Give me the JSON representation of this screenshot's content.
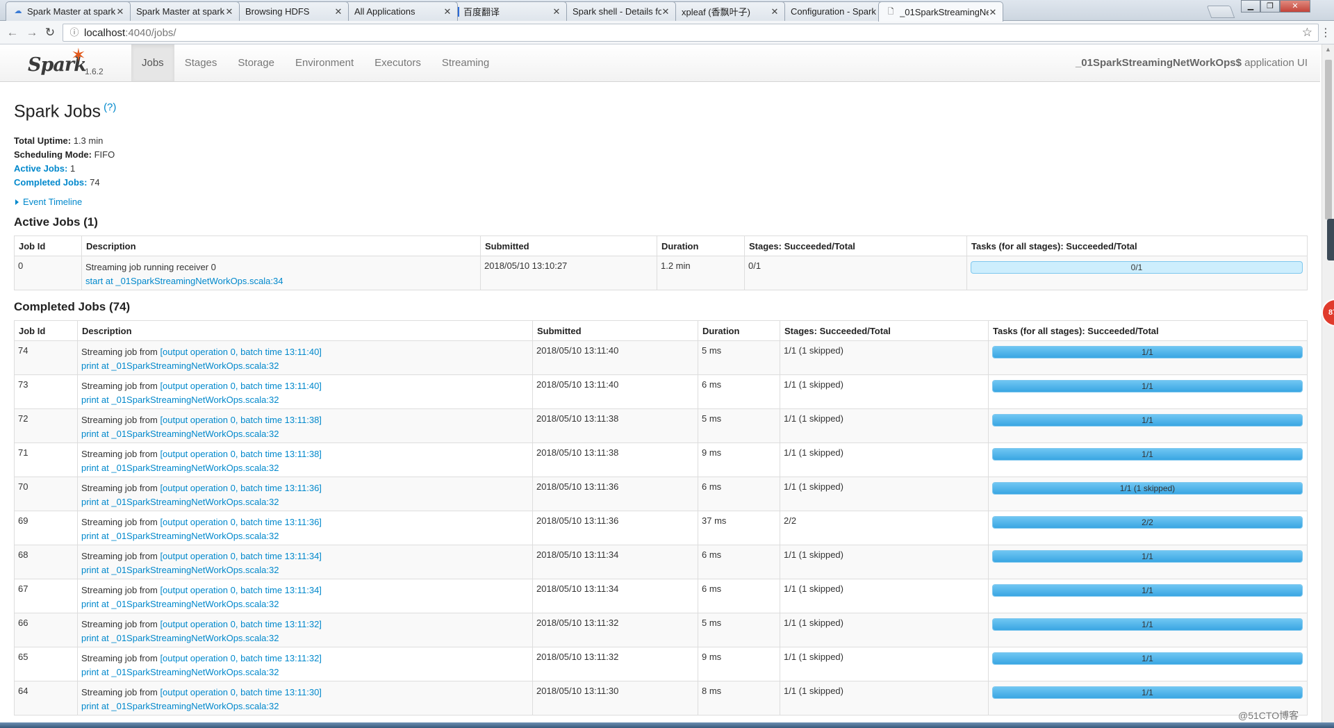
{
  "browser": {
    "tabs": [
      {
        "title": "Spark Master at spark:",
        "icon": "spark-icon",
        "active": false
      },
      {
        "title": "Spark Master at spark:",
        "icon": "page-icon",
        "active": false
      },
      {
        "title": "Browsing HDFS",
        "icon": "page-icon",
        "active": false
      },
      {
        "title": "All Applications",
        "icon": "page-icon",
        "active": false
      },
      {
        "title": "百度翻译",
        "icon": "translate-icon",
        "active": false
      },
      {
        "title": "Spark shell - Details fo",
        "icon": "page-icon",
        "active": false
      },
      {
        "title": "xpleaf (香飘叶子)",
        "icon": "github-icon",
        "active": false
      },
      {
        "title": "Configuration - Spark",
        "icon": "spark-star-icon",
        "active": false
      },
      {
        "title": "_01SparkStreamingNe",
        "icon": "page-icon",
        "active": true
      }
    ],
    "url_host": "localhost",
    "url_rest": ":4040/jobs/"
  },
  "spark_nav": {
    "logo_text": "Spark",
    "version": "1.6.2",
    "tabs": [
      "Jobs",
      "Stages",
      "Storage",
      "Environment",
      "Executors",
      "Streaming"
    ],
    "active_tab": "Jobs",
    "app_name": "_01SparkStreamingNetWorkOps$",
    "app_suffix": " application UI"
  },
  "page": {
    "title": "Spark Jobs",
    "help": "(?)",
    "summary": {
      "uptime_label": "Total Uptime:",
      "uptime_value": "1.3 min",
      "mode_label": "Scheduling Mode:",
      "mode_value": "FIFO",
      "active_label": "Active Jobs:",
      "active_value": "1",
      "completed_label": "Completed Jobs:",
      "completed_value": "74"
    },
    "event_timeline": "Event Timeline",
    "active_section": "Active Jobs (1)",
    "completed_section": "Completed Jobs (74)",
    "columns": [
      "Job Id",
      "Description",
      "Submitted",
      "Duration",
      "Stages: Succeeded/Total",
      "Tasks (for all stages): Succeeded/Total"
    ]
  },
  "active_jobs": [
    {
      "id": "0",
      "desc_text": "Streaming job running receiver 0",
      "desc_link": "",
      "call_site": "start at _01SparkStreamingNetWorkOps.scala:34",
      "submitted": "2018/05/10 13:10:27",
      "duration": "1.2 min",
      "stages": "0/1",
      "tasks": "0/1",
      "progress": 0
    }
  ],
  "completed_jobs": [
    {
      "id": "74",
      "desc_prefix": "Streaming job from ",
      "desc_link": "[output operation 0, batch time 13:11:40]",
      "call_site": "print at _01SparkStreamingNetWorkOps.scala:32",
      "submitted": "2018/05/10 13:11:40",
      "duration": "5 ms",
      "stages": "1/1 (1 skipped)",
      "tasks": "1/1",
      "progress": 1
    },
    {
      "id": "73",
      "desc_prefix": "Streaming job from ",
      "desc_link": "[output operation 0, batch time 13:11:40]",
      "call_site": "print at _01SparkStreamingNetWorkOps.scala:32",
      "submitted": "2018/05/10 13:11:40",
      "duration": "6 ms",
      "stages": "1/1 (1 skipped)",
      "tasks": "1/1",
      "progress": 1
    },
    {
      "id": "72",
      "desc_prefix": "Streaming job from ",
      "desc_link": "[output operation 0, batch time 13:11:38]",
      "call_site": "print at _01SparkStreamingNetWorkOps.scala:32",
      "submitted": "2018/05/10 13:11:38",
      "duration": "5 ms",
      "stages": "1/1 (1 skipped)",
      "tasks": "1/1",
      "progress": 1
    },
    {
      "id": "71",
      "desc_prefix": "Streaming job from ",
      "desc_link": "[output operation 0, batch time 13:11:38]",
      "call_site": "print at _01SparkStreamingNetWorkOps.scala:32",
      "submitted": "2018/05/10 13:11:38",
      "duration": "9 ms",
      "stages": "1/1 (1 skipped)",
      "tasks": "1/1",
      "progress": 1
    },
    {
      "id": "70",
      "desc_prefix": "Streaming job from ",
      "desc_link": "[output operation 0, batch time 13:11:36]",
      "call_site": "print at _01SparkStreamingNetWorkOps.scala:32",
      "submitted": "2018/05/10 13:11:36",
      "duration": "6 ms",
      "stages": "1/1 (1 skipped)",
      "tasks": "1/1 (1 skipped)",
      "progress": 1
    },
    {
      "id": "69",
      "desc_prefix": "Streaming job from ",
      "desc_link": "[output operation 0, batch time 13:11:36]",
      "call_site": "print at _01SparkStreamingNetWorkOps.scala:32",
      "submitted": "2018/05/10 13:11:36",
      "duration": "37 ms",
      "stages": "2/2",
      "tasks": "2/2",
      "progress": 1
    },
    {
      "id": "68",
      "desc_prefix": "Streaming job from ",
      "desc_link": "[output operation 0, batch time 13:11:34]",
      "call_site": "print at _01SparkStreamingNetWorkOps.scala:32",
      "submitted": "2018/05/10 13:11:34",
      "duration": "6 ms",
      "stages": "1/1 (1 skipped)",
      "tasks": "1/1",
      "progress": 1
    },
    {
      "id": "67",
      "desc_prefix": "Streaming job from ",
      "desc_link": "[output operation 0, batch time 13:11:34]",
      "call_site": "print at _01SparkStreamingNetWorkOps.scala:32",
      "submitted": "2018/05/10 13:11:34",
      "duration": "6 ms",
      "stages": "1/1 (1 skipped)",
      "tasks": "1/1",
      "progress": 1
    },
    {
      "id": "66",
      "desc_prefix": "Streaming job from ",
      "desc_link": "[output operation 0, batch time 13:11:32]",
      "call_site": "print at _01SparkStreamingNetWorkOps.scala:32",
      "submitted": "2018/05/10 13:11:32",
      "duration": "5 ms",
      "stages": "1/1 (1 skipped)",
      "tasks": "1/1",
      "progress": 1
    },
    {
      "id": "65",
      "desc_prefix": "Streaming job from ",
      "desc_link": "[output operation 0, batch time 13:11:32]",
      "call_site": "print at _01SparkStreamingNetWorkOps.scala:32",
      "submitted": "2018/05/10 13:11:32",
      "duration": "9 ms",
      "stages": "1/1 (1 skipped)",
      "tasks": "1/1",
      "progress": 1
    },
    {
      "id": "64",
      "desc_prefix": "Streaming job from ",
      "desc_link": "[output operation 0, batch time 13:11:30]",
      "call_site": "print at _01SparkStreamingNetWorkOps.scala:32",
      "submitted": "2018/05/10 13:11:30",
      "duration": "8 ms",
      "stages": "1/1 (1 skipped)",
      "tasks": "1/1",
      "progress": 1
    }
  ],
  "overlay": {
    "badge": "87",
    "watermark": "@51CTO博客"
  },
  "colors": {
    "link": "#0088cc",
    "progress_fill": "#3aa6e3",
    "progress_bg": "#cdeefd",
    "spark_orange": "#e25a1c"
  }
}
